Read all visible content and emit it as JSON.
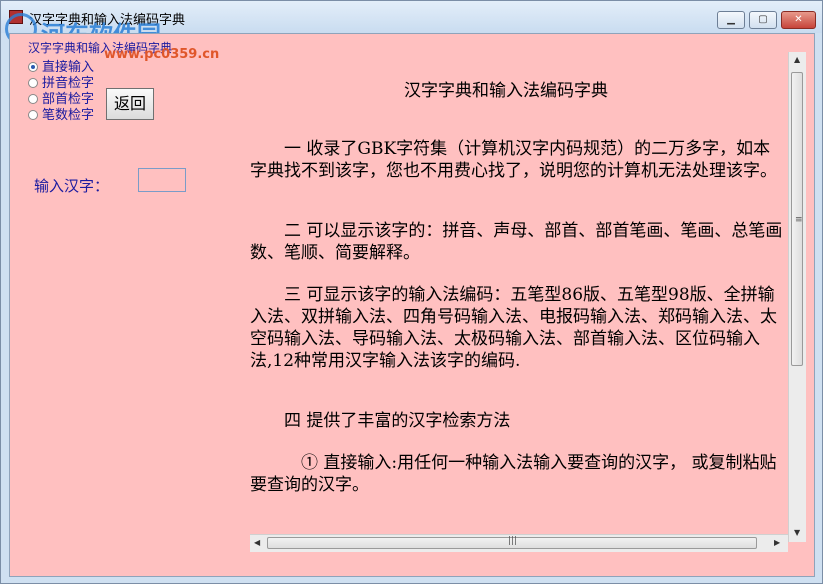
{
  "window": {
    "title": "汉字字典和输入法编码字典",
    "minimize_label": "▁",
    "maximize_label": "▢",
    "close_label": "✕"
  },
  "watermark": {
    "site": "河东软件园",
    "url": "www.pc0359.cn"
  },
  "search_panel": {
    "group_label": "汉字字典和输入法编码字典",
    "options": [
      {
        "label": "直接输入",
        "checked": true
      },
      {
        "label": "拼音检字",
        "checked": false
      },
      {
        "label": "部首检字",
        "checked": false
      },
      {
        "label": "笔数检字",
        "checked": false
      }
    ],
    "back_label": "返回",
    "input_label": "输入汉字：",
    "input_value": ""
  },
  "content": {
    "heading": "汉字字典和输入法编码字典",
    "paragraphs": [
      "　　一 收录了GBK字符集（计算机汉字内码规范）的二万多字，如本字典找不到该字，您也不用费心找了，说明您的计算机无法处理该字。",
      "　　二 可以显示该字的：拼音、声母、部首、部首笔画、笔画、总笔画数、笔顺、简要解释。",
      "　　三 可显示该字的输入法编码：五笔型86版、五笔型98版、全拼输入法、双拼输入法、四角号码输入法、电报码输入法、郑码输入法、太空码输入法、导码输入法、太极码输入法、部首输入法、区位码输入法,12种常用汉字输入法该字的编码.",
      "　　四 提供了丰富的汉字检索方法",
      "　　　① 直接输入:用任何一种输入法输入要查询的汉字， 或复制粘贴要查询的汉字。"
    ]
  },
  "scrollbars": {
    "vertical_position": 0.0,
    "horizontal_position": 0.0
  },
  "colors": {
    "background": "#ffc0c0",
    "label_text": "#1a1aa0",
    "titlebar": "#cfe0f1"
  },
  "icons": {
    "app": "app-icon",
    "logo": "watermark-logo"
  }
}
